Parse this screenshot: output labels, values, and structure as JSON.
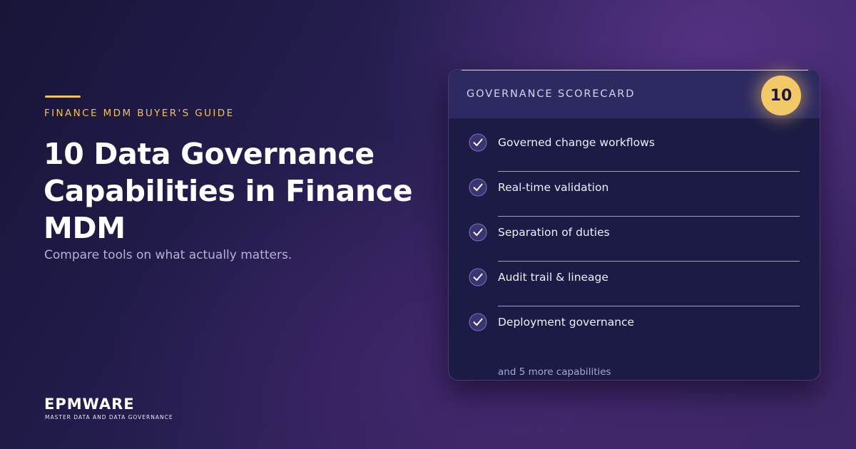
{
  "hero": {
    "eyebrow": "FINANCE MDM BUYER'S GUIDE",
    "headline": "10 Data Governance Capabilities in Finance MDM",
    "subline": "Compare tools on what actually matters."
  },
  "brand": {
    "wordmark": "EPMWARE",
    "tagline": "MASTER DATA AND DATA GOVERNANCE"
  },
  "scorecard": {
    "title": "GOVERNANCE SCORECARD",
    "score": "10",
    "items": [
      {
        "label": "Governed change workflows",
        "icon": "check-circle-icon"
      },
      {
        "label": "Real-time validation",
        "icon": "check-circle-icon"
      },
      {
        "label": "Separation of duties",
        "icon": "check-circle-icon"
      },
      {
        "label": "Audit trail & lineage",
        "icon": "check-circle-icon"
      },
      {
        "label": "Deployment governance",
        "icon": "check-circle-icon"
      }
    ],
    "more": "and 5 more capabilities"
  },
  "colors": {
    "accent": "#f2c15c",
    "background": "#241d4e",
    "card": "#1c1b45",
    "card_header": "#2d2a62",
    "check_circle": "#3a3472",
    "check_mark": "#ffffff"
  }
}
